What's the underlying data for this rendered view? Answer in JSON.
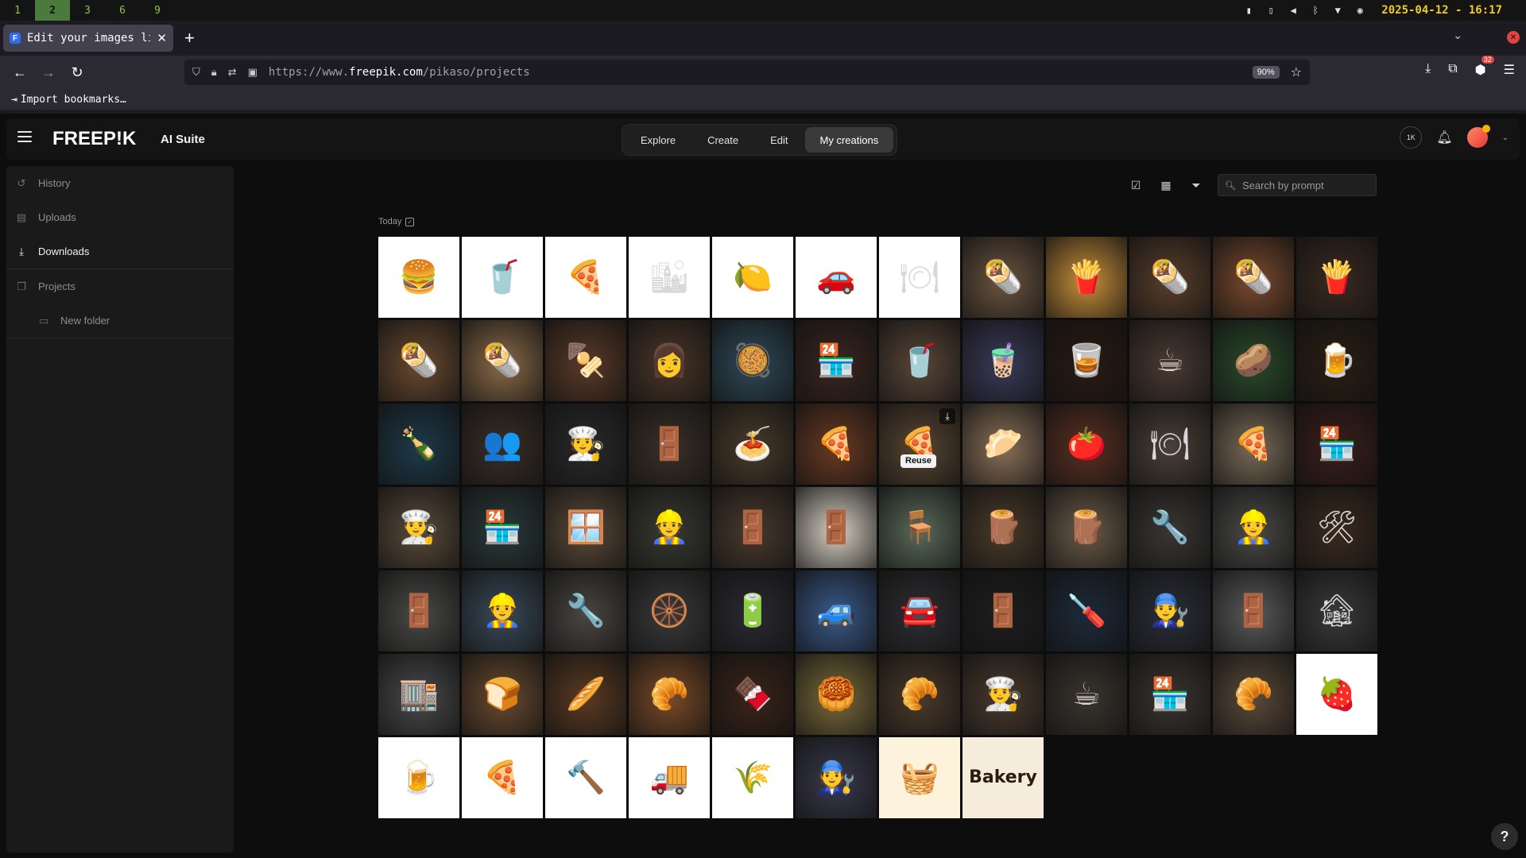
{
  "os": {
    "workspaces": [
      "1",
      "2",
      "3",
      "6",
      "9"
    ],
    "active_workspace": "2",
    "clock": "2025-04-12 - 16:17",
    "tray_icons": [
      "battery-icon",
      "usb-icon",
      "volume-icon",
      "bluetooth-icon",
      "wifi-icon",
      "vpn-icon"
    ]
  },
  "browser": {
    "tab_title": "Edit your images like",
    "url_prefix": "https://www.",
    "url_host": "freepik.com",
    "url_path": "/pikaso/projects",
    "zoom": "90%",
    "bookmarks_import": "Import bookmarks…",
    "extension_badge": "32"
  },
  "app": {
    "logo": "FREEP!K",
    "suite_label": "AI Suite",
    "nav": [
      "Explore",
      "Create",
      "Edit",
      "My creations"
    ],
    "active_nav": "My creations",
    "credits_label": "1K"
  },
  "sidebar": {
    "items": [
      {
        "label": "History",
        "icon": "history-icon"
      },
      {
        "label": "Uploads",
        "icon": "uploads-icon"
      },
      {
        "label": "Downloads",
        "icon": "download-icon",
        "active": true
      },
      {
        "label": "Projects",
        "icon": "projects-icon"
      },
      {
        "label": "New folder",
        "icon": "folder-icon"
      }
    ]
  },
  "toolbar": {
    "search_placeholder": "Search by prompt"
  },
  "section": {
    "today_label": "Today"
  },
  "grid": {
    "hover_action": "Reuse",
    "tiles": [
      {
        "n": "burger-logo",
        "bg": "#ffffff",
        "g": "🍔",
        "l": 1
      },
      {
        "n": "drink-mascot-logo",
        "bg": "#ffffff",
        "g": "🥤",
        "l": 1
      },
      {
        "n": "pizza-slice-logo",
        "bg": "#ffffff",
        "g": "🍕",
        "l": 1
      },
      {
        "n": "city-logo",
        "bg": "#ffffff",
        "g": "🏙",
        "l": 1
      },
      {
        "n": "fruit-logo",
        "bg": "#ffffff",
        "g": "🍋",
        "l": 1
      },
      {
        "n": "car-flame-logo",
        "bg": "#ffffff",
        "g": "🚗",
        "l": 1
      },
      {
        "n": "smiley-food-logo",
        "bg": "#ffffff",
        "g": "🍽",
        "l": 1
      },
      {
        "n": "gyro-wrap",
        "bg": "#6b5540",
        "g": "🌯"
      },
      {
        "n": "french-fries",
        "bg": "#c98f3a",
        "g": "🍟"
      },
      {
        "n": "kebab-wrap",
        "bg": "#5a3f2a",
        "g": "🌯"
      },
      {
        "n": "shawarma",
        "bg": "#7a4a2e",
        "g": "🌯"
      },
      {
        "n": "fries-box",
        "bg": "#3a2a20",
        "g": "🍟"
      },
      {
        "n": "wrap-plate",
        "bg": "#6a4a30",
        "g": "🌯"
      },
      {
        "n": "burrito",
        "bg": "#8a6a48",
        "g": "🌯"
      },
      {
        "n": "skewers",
        "bg": "#5a3a28",
        "g": "🍢"
      },
      {
        "n": "waitress",
        "bg": "#4a3628",
        "g": "👩"
      },
      {
        "n": "food-counter",
        "bg": "#2f4a5a",
        "g": "🥘"
      },
      {
        "n": "restaurant-front",
        "bg": "#3a2620",
        "g": "🏪"
      },
      {
        "n": "milkshakes",
        "bg": "#5a4638",
        "g": "🥤"
      },
      {
        "n": "bubble-tea",
        "bg": "#3a3a5a",
        "g": "🧋"
      },
      {
        "n": "rum-bottles",
        "bg": "#2a1a12",
        "g": "🥃"
      },
      {
        "n": "coffee-bags",
        "bg": "#4a3a32",
        "g": "☕"
      },
      {
        "n": "chips-bags",
        "bg": "#2a4a2a",
        "g": "🥔"
      },
      {
        "n": "beer-glasses",
        "bg": "#2a1e14",
        "g": "🍺"
      },
      {
        "n": "liquor-shelf",
        "bg": "#1e3a4a",
        "g": "🍾"
      },
      {
        "n": "cafe-people",
        "bg": "#3a2e26",
        "g": "👥"
      },
      {
        "n": "bar-staff",
        "bg": "#2a2a2a",
        "g": "🧑‍🍳"
      },
      {
        "n": "shop-entrance",
        "bg": "#3a3028",
        "g": "🚪"
      },
      {
        "n": "spaghetti",
        "bg": "#4a3a2a",
        "g": "🍝"
      },
      {
        "n": "pizza",
        "bg": "#6a3a22",
        "g": "🍕"
      },
      {
        "n": "pizza-hover",
        "bg": "#5a4632",
        "g": "🍕",
        "hover": 1
      },
      {
        "n": "calzone",
        "bg": "#8a7058",
        "g": "🥟"
      },
      {
        "n": "bruschetta",
        "bg": "#5a3020",
        "g": "🍅"
      },
      {
        "n": "dinner-table",
        "bg": "#4a4038",
        "g": "🍽"
      },
      {
        "n": "pizza-board",
        "bg": "#7a6a58",
        "g": "🍕"
      },
      {
        "n": "pizzeria-front",
        "bg": "#3a1e1a",
        "g": "🏪"
      },
      {
        "n": "chefs-team",
        "bg": "#5a4a3a",
        "g": "👨‍🍳"
      },
      {
        "n": "pizzeria-outdoor",
        "bg": "#2a3a3a",
        "g": "🏪"
      },
      {
        "n": "window-repair",
        "bg": "#5a4a38",
        "g": "🪟"
      },
      {
        "n": "stairs-work",
        "bg": "#3a3a32",
        "g": "👷"
      },
      {
        "n": "door-install",
        "bg": "#4a3a2e",
        "g": "🚪"
      },
      {
        "n": "door-white",
        "bg": "#d8d0c4",
        "g": "🚪"
      },
      {
        "n": "chair-paint",
        "bg": "#5a6a5a",
        "g": "🪑"
      },
      {
        "n": "wood-table",
        "bg": "#4a3a2a",
        "g": "🪵"
      },
      {
        "n": "workbench",
        "bg": "#6a5a48",
        "g": "🪵"
      },
      {
        "n": "tools-wall",
        "bg": "#3a3632",
        "g": "🔧"
      },
      {
        "n": "workers-group",
        "bg": "#4a4a48",
        "g": "👷"
      },
      {
        "n": "workshop",
        "bg": "#3a2a1e",
        "g": "🛠"
      },
      {
        "n": "building-door",
        "bg": "#4a4a48",
        "g": "🚪"
      },
      {
        "n": "windshield-worker",
        "bg": "#3a4a5a",
        "g": "👷"
      },
      {
        "n": "car-repair",
        "bg": "#4a4642",
        "g": "🔧"
      },
      {
        "n": "mechanic-tire",
        "bg": "#3a3a3a",
        "g": "🛞"
      },
      {
        "n": "diagnostic-tool",
        "bg": "#2a2a32",
        "g": "🔋"
      },
      {
        "n": "blue-car",
        "bg": "#3a5a8a",
        "g": "🚙"
      },
      {
        "n": "car-detail",
        "bg": "#2e2e32",
        "g": "🚘"
      },
      {
        "n": "dark-door",
        "bg": "#1e1e1e",
        "g": "🚪"
      },
      {
        "n": "tools-closeup",
        "bg": "#1e2a3a",
        "g": "🪛"
      },
      {
        "n": "mechanics-team",
        "bg": "#2a2e38",
        "g": "👨‍🔧"
      },
      {
        "n": "grey-door",
        "bg": "#5a5a5a",
        "g": "🚪"
      },
      {
        "n": "garage",
        "bg": "#3a3a3a",
        "g": "🏚"
      },
      {
        "n": "storefront",
        "bg": "#4a4a4a",
        "g": "🏬"
      },
      {
        "n": "bread-bun",
        "bg": "#6a4a30",
        "g": "🍞"
      },
      {
        "n": "bread-loaf",
        "bg": "#5a3a22",
        "g": "🥖"
      },
      {
        "n": "bread-rolls",
        "bg": "#7a4a28",
        "g": "🥐"
      },
      {
        "n": "brownies",
        "bg": "#3a2418",
        "g": "🍫"
      },
      {
        "n": "baklava",
        "bg": "#7a6a3a",
        "g": "🥮"
      },
      {
        "n": "croissants",
        "bg": "#4a3a2a",
        "g": "🥐"
      },
      {
        "n": "bakers",
        "bg": "#4a3a2e",
        "g": "👨‍🍳"
      },
      {
        "n": "cafe-interior",
        "bg": "#3a342e",
        "g": "☕"
      },
      {
        "n": "bakery-front",
        "bg": "#3a3430",
        "g": "🏪"
      },
      {
        "n": "pastry-display",
        "bg": "#5a4a3a",
        "g": "🥐"
      },
      {
        "n": "fruit-logo-2",
        "bg": "#ffffff",
        "g": "🍓",
        "l": 1
      },
      {
        "n": "beer-logo",
        "bg": "#ffffff",
        "g": "🍺",
        "l": 1
      },
      {
        "n": "pizza-logo",
        "bg": "#ffffff",
        "g": "🍕",
        "l": 1
      },
      {
        "n": "tools-logo",
        "bg": "#ffffff",
        "g": "🔨",
        "l": 1
      },
      {
        "n": "truck-logo",
        "bg": "#ffffff",
        "g": "🚚",
        "l": 1
      },
      {
        "n": "wheat-logo",
        "bg": "#ffffff",
        "g": "🌾",
        "l": 1
      },
      {
        "n": "mechanic-logo",
        "bg": "#3a3a4e",
        "g": "🧑‍🔧"
      },
      {
        "n": "basket-logo",
        "bg": "#fdf3dc",
        "g": "🧺",
        "l": 1
      },
      {
        "n": "bakery-logo",
        "bg": "#f5ecdb",
        "t": "Bakery",
        "l": 1
      }
    ]
  }
}
